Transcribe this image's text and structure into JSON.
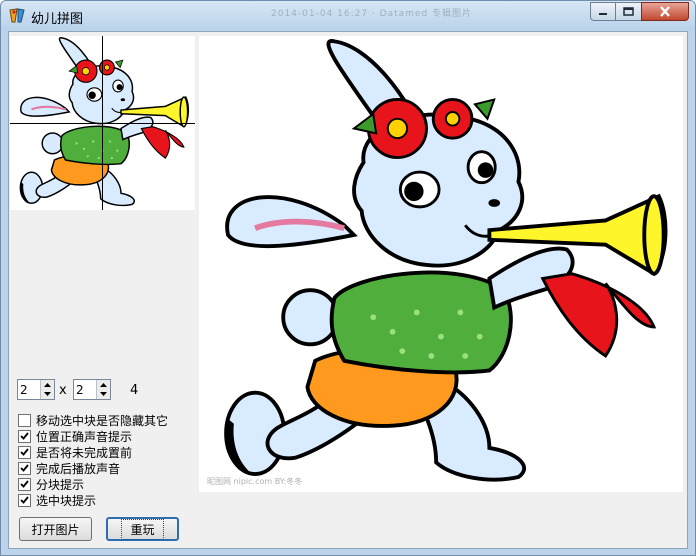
{
  "window": {
    "title": "幼儿拼图",
    "background_title_text": "2014-01-04 16:27   ·  Datamed 专辑图片",
    "icon": "app-puzzle-icon"
  },
  "window_controls": {
    "minimize_icon": "minimize-icon",
    "maximize_icon": "maximize-icon",
    "close_icon": "close-icon"
  },
  "preview": {
    "description_icon": "rabbit-trumpet-thumbnail"
  },
  "puzzle": {
    "watermark": "昵图网 nipic.com  BY:冬冬"
  },
  "grid": {
    "rows": "2",
    "cols": "2",
    "times_symbol": "x",
    "pieces_count": "4"
  },
  "options": [
    {
      "label": "移动选中块是否隐藏其它",
      "checked": false
    },
    {
      "label": "位置正确声音提示",
      "checked": true
    },
    {
      "label": "是否将未完成置前",
      "checked": true
    },
    {
      "label": "完成后播放声音",
      "checked": true
    },
    {
      "label": "分块提示",
      "checked": true
    },
    {
      "label": "选中块提示",
      "checked": true
    }
  ],
  "buttons": {
    "open_image": "打开图片",
    "replay": "重玩"
  },
  "colors": {
    "title_bar": "#c8dcf0",
    "close_button": "#c2482f",
    "client_bg": "#f0f0f0",
    "focus_border": "#2f6db3"
  }
}
